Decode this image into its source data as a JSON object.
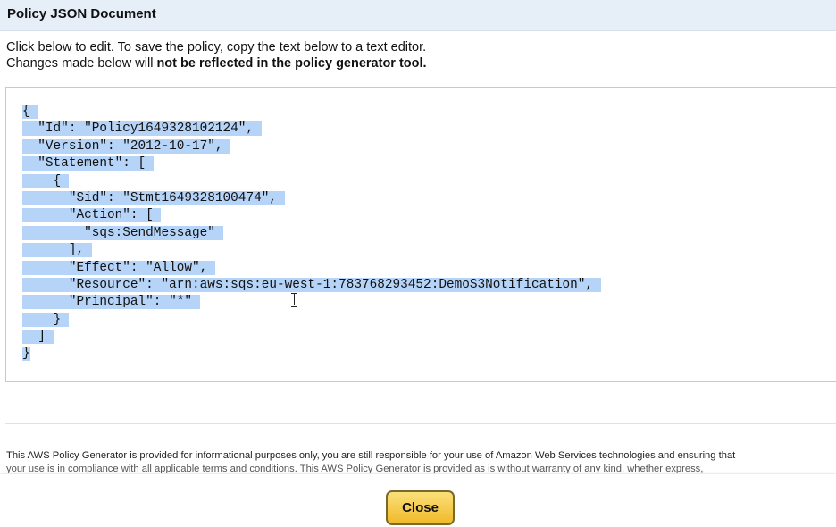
{
  "modal": {
    "title": "Policy JSON Document",
    "instructions_line1": "Click below to edit. To save the policy, copy the text below to a text editor.",
    "instructions_line2_prefix": "Changes made below will ",
    "instructions_line2_bold": "not be reflected in the policy generator tool."
  },
  "policy_json": {
    "lines": [
      "{",
      "  \"Id\": \"Policy1649328102124\",",
      "  \"Version\": \"2012-10-17\",",
      "  \"Statement\": [",
      "    {",
      "      \"Sid\": \"Stmt1649328100474\",",
      "      \"Action\": [",
      "        \"sqs:SendMessage\"",
      "      ],",
      "      \"Effect\": \"Allow\",",
      "      \"Resource\": \"arn:aws:sqs:eu-west-1:783768293452:DemoS3Notification\",",
      "      \"Principal\": \"*\"",
      "    }",
      "  ]",
      "}"
    ]
  },
  "disclaimer": {
    "line1": "This AWS Policy Generator is provided for informational purposes only, you are still responsible for your use of Amazon Web Services technologies and ensuring that",
    "line2": "your use is in compliance with all applicable terms and conditions. This AWS Policy Generator is provided as is without warranty of any kind, whether express,"
  },
  "footer": {
    "close_label": "Close"
  },
  "colors": {
    "selection": "#b6d4f8",
    "header_bg": "#e6eef8",
    "button_gold": "#f0b92a"
  }
}
